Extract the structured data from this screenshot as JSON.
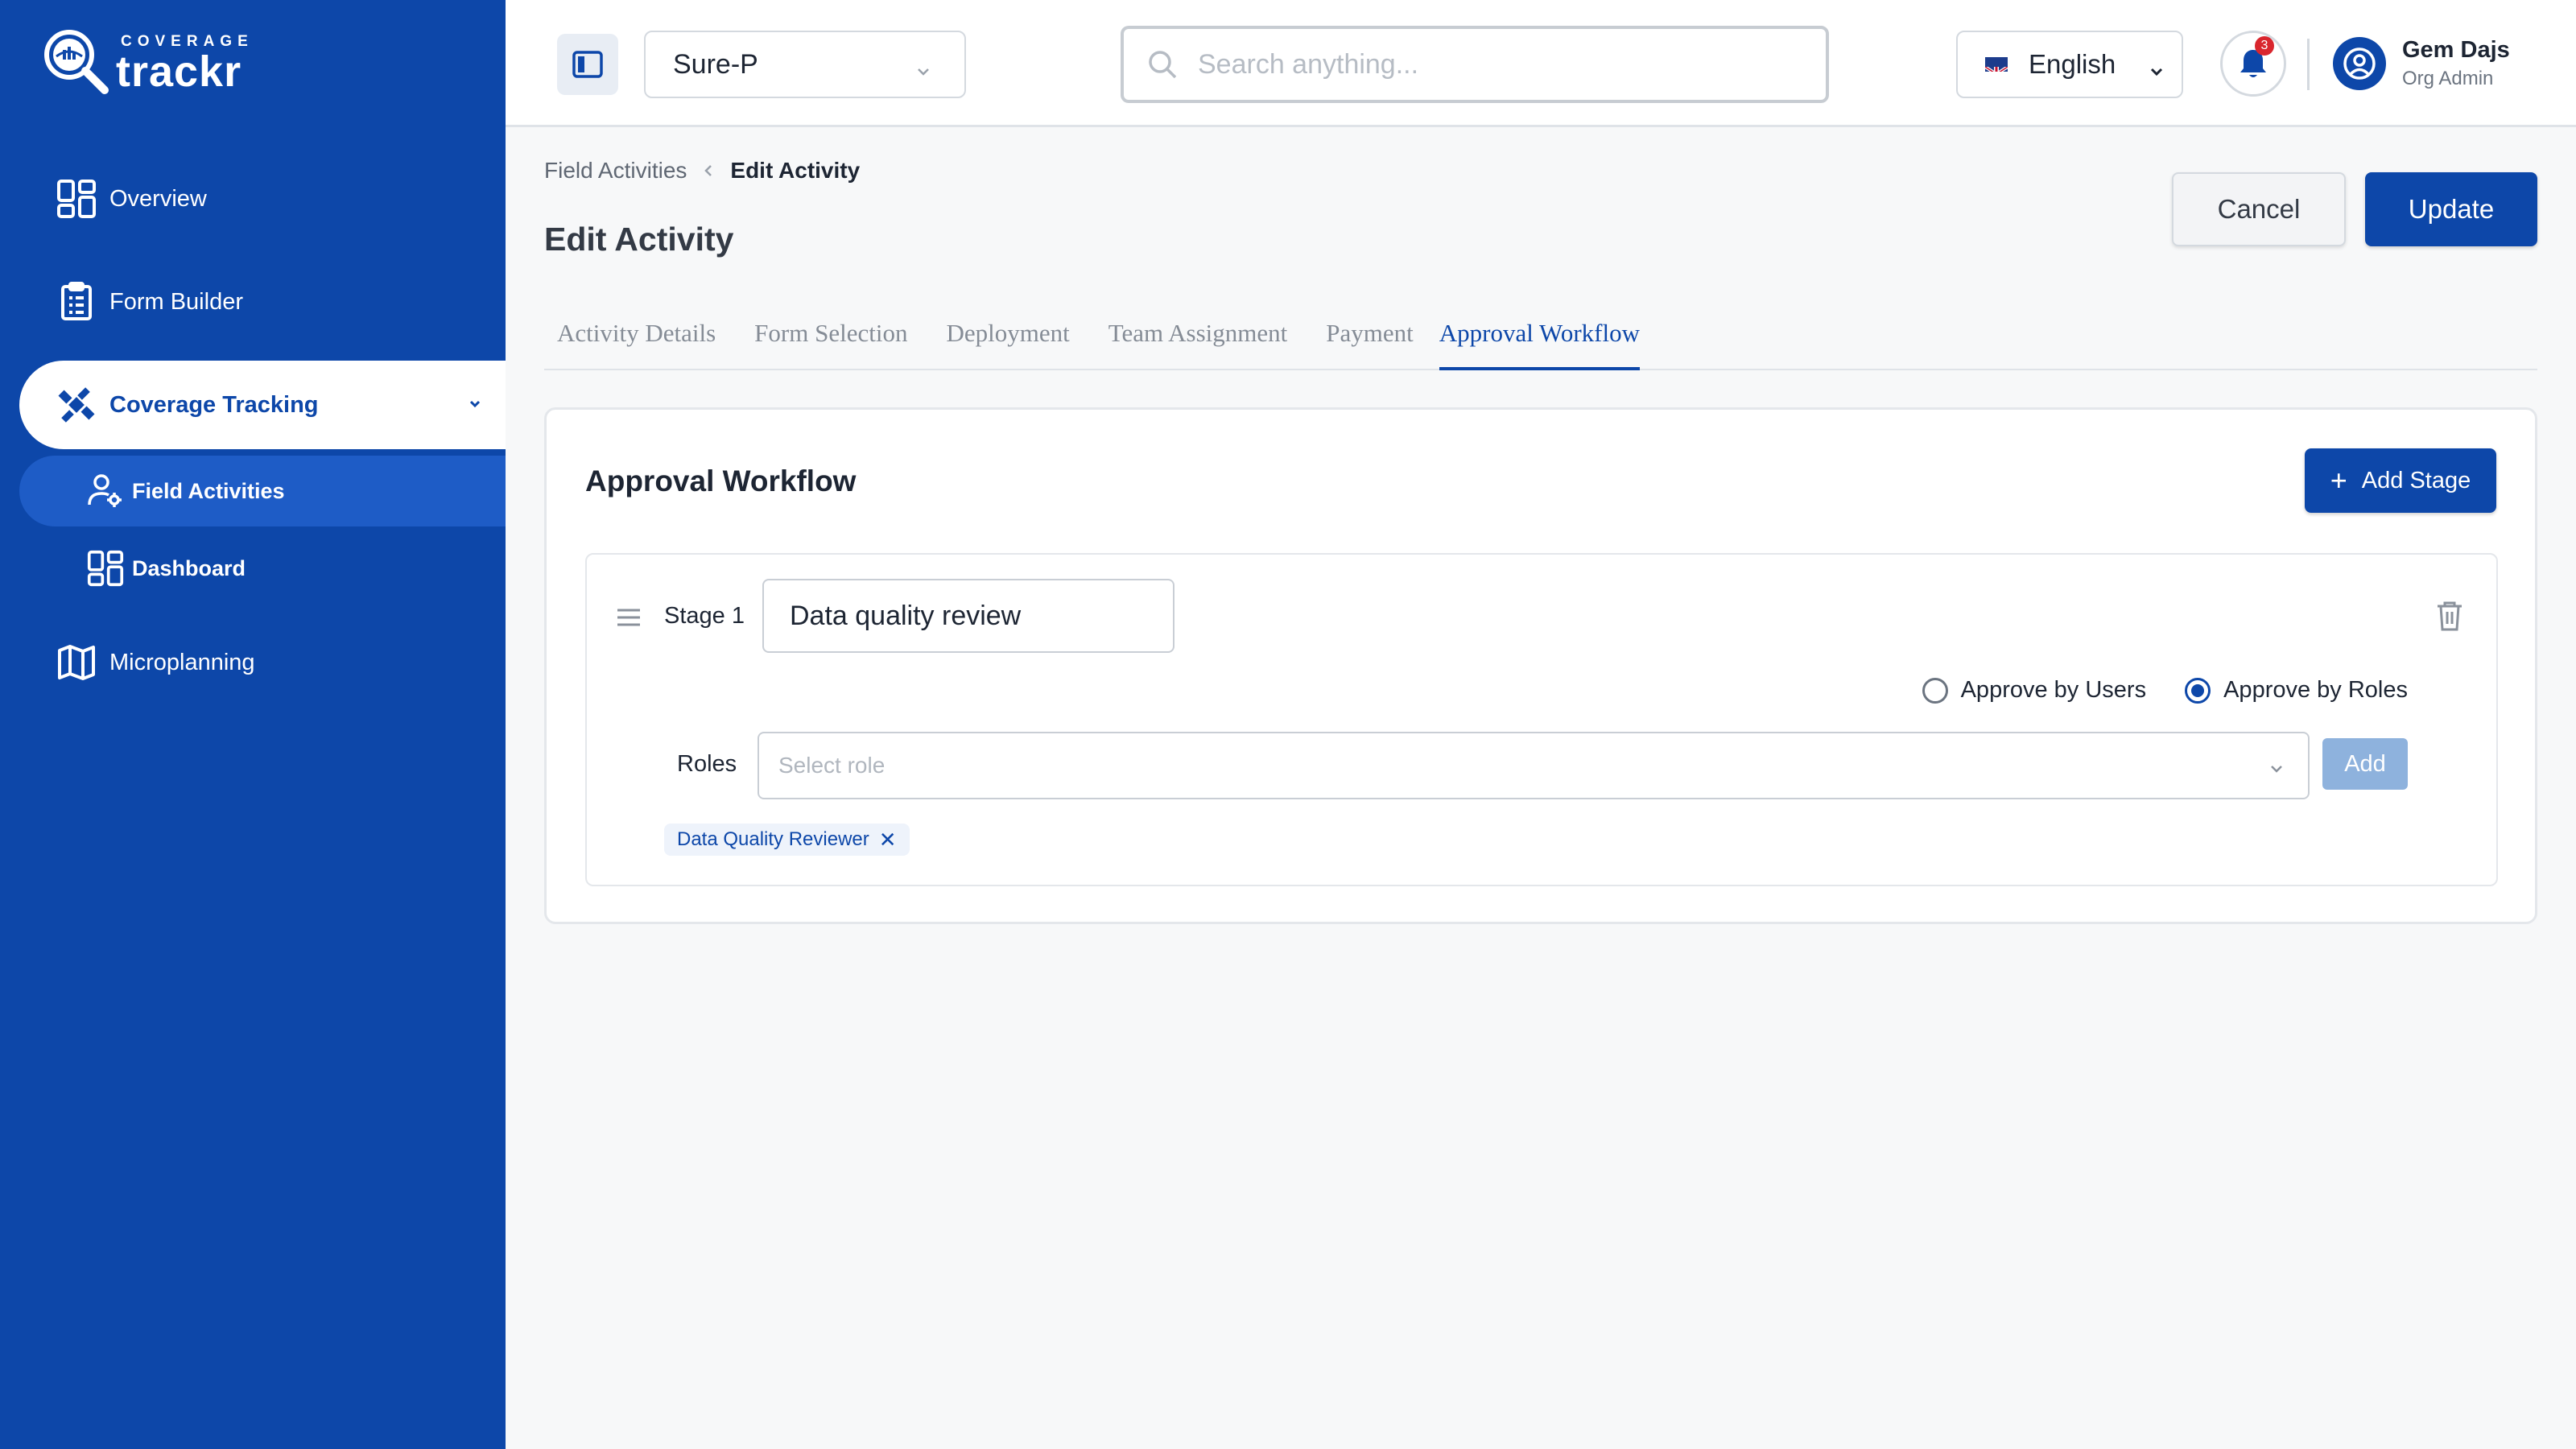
{
  "brand": {
    "sub": "COVERAGE",
    "name": "trackr"
  },
  "sidebar": {
    "items": [
      {
        "label": "Overview"
      },
      {
        "label": "Form Builder"
      },
      {
        "label": "Coverage Tracking"
      },
      {
        "label": "Field Activities"
      },
      {
        "label": "Dashboard"
      },
      {
        "label": "Microplanning"
      }
    ]
  },
  "header": {
    "project": "Sure-P",
    "search_placeholder": "Search anything...",
    "language": "English",
    "notification_count": "3",
    "user": {
      "name": "Gem Dajs",
      "role": "Org Admin"
    }
  },
  "breadcrumb": {
    "parent": "Field Activities",
    "current": "Edit Activity"
  },
  "page": {
    "title": "Edit Activity",
    "cancel_label": "Cancel",
    "update_label": "Update"
  },
  "tabs": [
    {
      "label": "Activity Details"
    },
    {
      "label": "Form Selection"
    },
    {
      "label": "Deployment"
    },
    {
      "label": "Team Assignment"
    },
    {
      "label": "Payment"
    },
    {
      "label": "Approval Workflow"
    }
  ],
  "workflow": {
    "title": "Approval Workflow",
    "add_stage_label": "Add Stage",
    "stage": {
      "label": "Stage 1",
      "name": "Data quality review",
      "approve_by_users": "Approve by Users",
      "approve_by_roles": "Approve by Roles",
      "roles_label": "Roles",
      "roles_placeholder": "Select role",
      "add_label": "Add",
      "selected_roles": [
        "Data Quality Reviewer"
      ]
    }
  },
  "colors": {
    "primary": "#0d47a9",
    "sidebar": "#0d47a9",
    "badge": "#d9262e"
  }
}
